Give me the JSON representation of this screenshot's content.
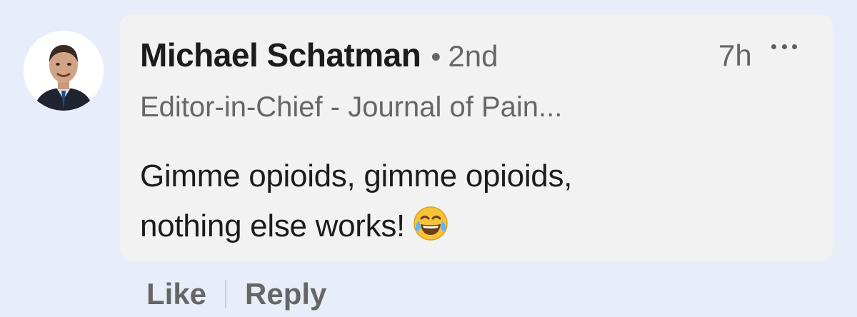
{
  "comment": {
    "author": {
      "name": "Michael Schatman",
      "connection_degree": "2nd",
      "headline": "Editor-in-Chief - Journal of Pain...",
      "avatar_icon": "person-portrait-icon"
    },
    "separator": "•",
    "timestamp": "7h",
    "more_icon": "more-horizontal-icon",
    "text_line1": "Gimme opioids, gimme opioids,",
    "text_line2": "nothing else works!",
    "emoji_icon": "face-with-tears-of-joy-icon"
  },
  "actions": {
    "like_label": "Like",
    "reply_label": "Reply"
  },
  "colors": {
    "page_background": "#e8eef9",
    "bubble_background": "#f2f2f2",
    "primary_text": "#1c1c1c",
    "secondary_text": "#666666"
  }
}
